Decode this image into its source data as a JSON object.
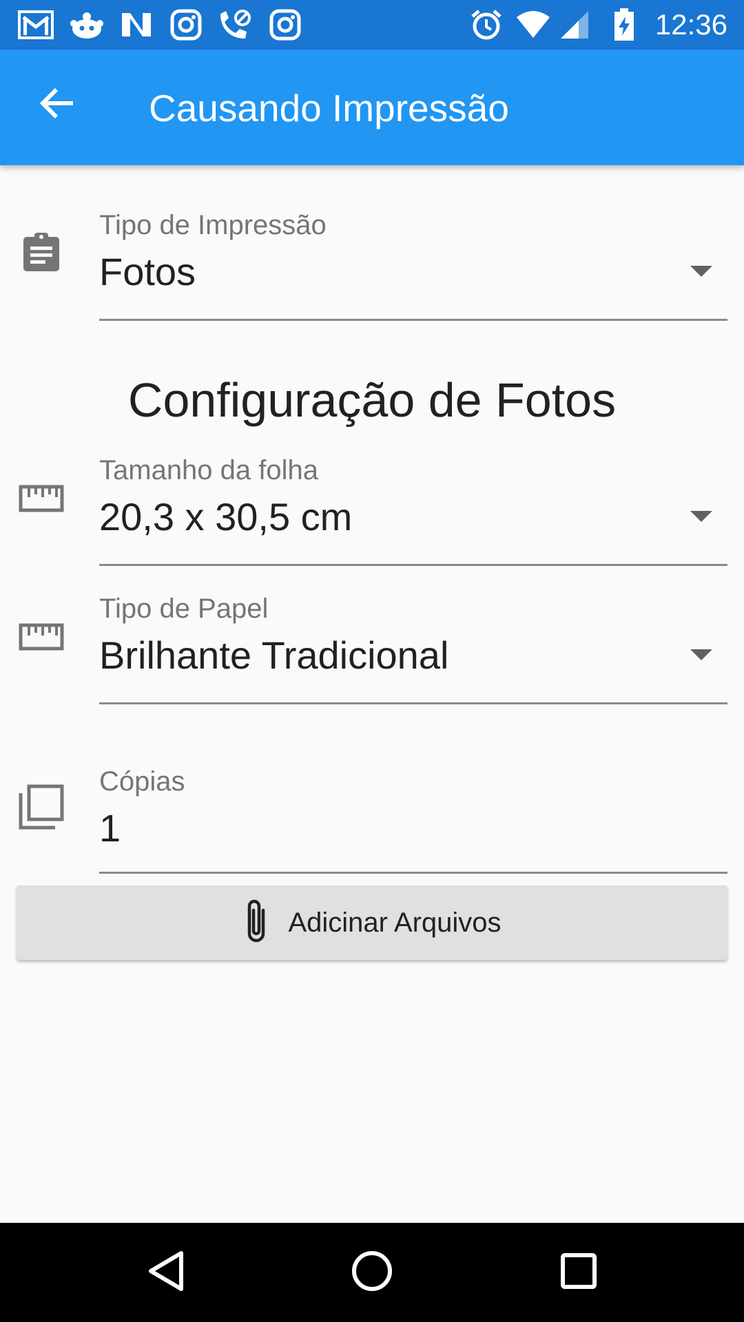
{
  "status_bar": {
    "time": "12:36",
    "left_icons": [
      "gmail-icon",
      "reddit-icon",
      "news-icon",
      "instagram-icon",
      "missed-call-icon",
      "instagram-icon"
    ],
    "right_icons": [
      "alarm-icon",
      "wifi-icon",
      "cell-signal-icon",
      "battery-charging-icon"
    ]
  },
  "app_bar": {
    "title": "Causando Impressão",
    "back_icon": "arrow-back-icon",
    "color": "#2196f3"
  },
  "print_type": {
    "label": "Tipo de Impressão",
    "value": "Fotos",
    "icon": "clipboard-icon"
  },
  "section": {
    "title": "Configuração de Fotos"
  },
  "sheet_size": {
    "label": "Tamanho da folha",
    "value": "20,3 x 30,5 cm",
    "icon": "ruler-icon"
  },
  "paper_type": {
    "label": "Tipo de Papel",
    "value": "Brilhante Tradicional",
    "icon": "ruler-icon"
  },
  "copies": {
    "label": "Cópias",
    "value": "1",
    "icon": "copy-icon"
  },
  "attach_button": {
    "label": "Adicinar Arquivos",
    "icon": "paperclip-icon"
  },
  "nav_bar": {
    "buttons": [
      "back-triangle-icon",
      "home-circle-icon",
      "recents-square-icon"
    ]
  }
}
